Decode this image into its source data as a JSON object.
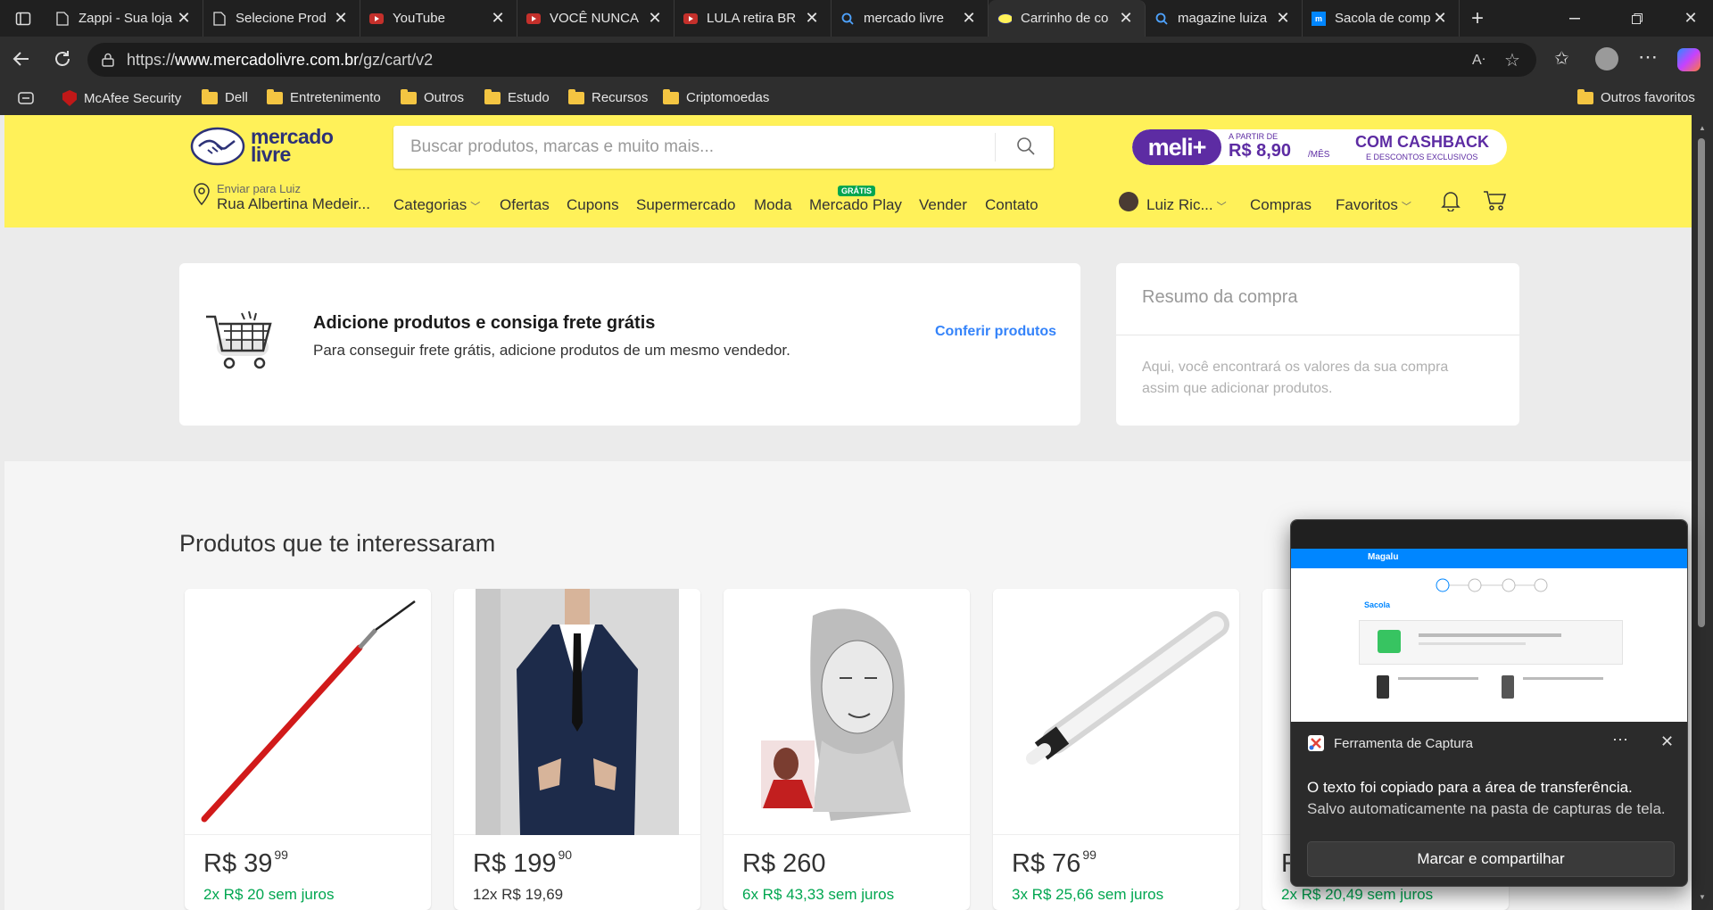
{
  "tabs": [
    {
      "title": "Zappi - Sua loja",
      "icon": "page-icon"
    },
    {
      "title": "Selecione Prod",
      "icon": "page-icon"
    },
    {
      "title": "YouTube",
      "icon": "youtube-icon"
    },
    {
      "title": "VOCÊ NUNCA",
      "icon": "youtube-icon"
    },
    {
      "title": "LULA retira BR",
      "icon": "youtube-icon"
    },
    {
      "title": "mercado livre",
      "icon": "search-icon"
    },
    {
      "title": "Carrinho de co",
      "icon": "mercadolivre-icon"
    },
    {
      "title": "magazine luiza",
      "icon": "search-icon"
    },
    {
      "title": "Sacola de comp",
      "icon": "magalu-icon"
    }
  ],
  "address": {
    "prefix": "https://",
    "host": "www.mercadolivre.com.br",
    "path": "/gz/cart/v2"
  },
  "bookmarks": {
    "items": [
      "McAfee Security",
      "Dell",
      "Entretenimento",
      "Outros",
      "Estudo",
      "Recursos",
      "Criptomoedas"
    ],
    "other": "Outros favoritos"
  },
  "header": {
    "logo_line1": "mercado",
    "logo_line2": "livre",
    "search_placeholder": "Buscar produtos, marcas e muito mais...",
    "promo": {
      "brand": "meli+",
      "small": "A PARTIR DE",
      "price": "R$ 8,90",
      "per": "/MÊS",
      "cashback": "COM CASHBACK",
      "sub": "E DESCONTOS EXCLUSIVOS"
    },
    "ship_to": "Enviar para Luiz",
    "address": "Rua Albertina Medeir...",
    "nav": [
      "Categorias",
      "Ofertas",
      "Cupons",
      "Supermercado",
      "Moda",
      "Mercado Play",
      "Vender",
      "Contato"
    ],
    "play_badge": "GRÁTIS",
    "user": "Luiz Ric...",
    "compras": "Compras",
    "favoritos": "Favoritos"
  },
  "cart": {
    "title": "Adicione produtos e consiga frete grátis",
    "subtitle": "Para conseguir frete grátis, adicione produtos de um mesmo vendedor.",
    "link": "Conferir produtos"
  },
  "summary": {
    "title": "Resumo da compra",
    "text_line1": "Aqui, você encontrará os valores da sua compra",
    "text_line2": "assim que adicionar produtos."
  },
  "section_title": "Produtos que te interessaram",
  "products": [
    {
      "price": "R$ 39",
      "cents": "99",
      "installments": "2x R$ 20 sem juros",
      "interest_free": true
    },
    {
      "price": "R$ 199",
      "cents": "90",
      "installments": "12x R$ 19,69",
      "interest_free": false
    },
    {
      "price": "R$ 260",
      "cents": "",
      "installments": "6x R$ 43,33 sem juros",
      "interest_free": true
    },
    {
      "price": "R$ 76",
      "cents": "99",
      "installments": "3x R$ 25,66 sem juros",
      "interest_free": true
    },
    {
      "price": "R$",
      "cents": "",
      "installments": "2x R$ 20,49 sem juros",
      "interest_free": true
    }
  ],
  "notification": {
    "app": "Ferramenta de Captura",
    "line1": "O texto foi copiado para a área de transferência.",
    "line2": "Salvo automaticamente na pasta de capturas de tela.",
    "button": "Marcar e compartilhar",
    "preview_logo": "Magalu",
    "preview_title": "Sacola"
  },
  "colors": {
    "ml_yellow": "#fff159",
    "ml_blue": "#3483fa",
    "ml_green": "#00a650",
    "meli_purple": "#5d2ca3"
  }
}
